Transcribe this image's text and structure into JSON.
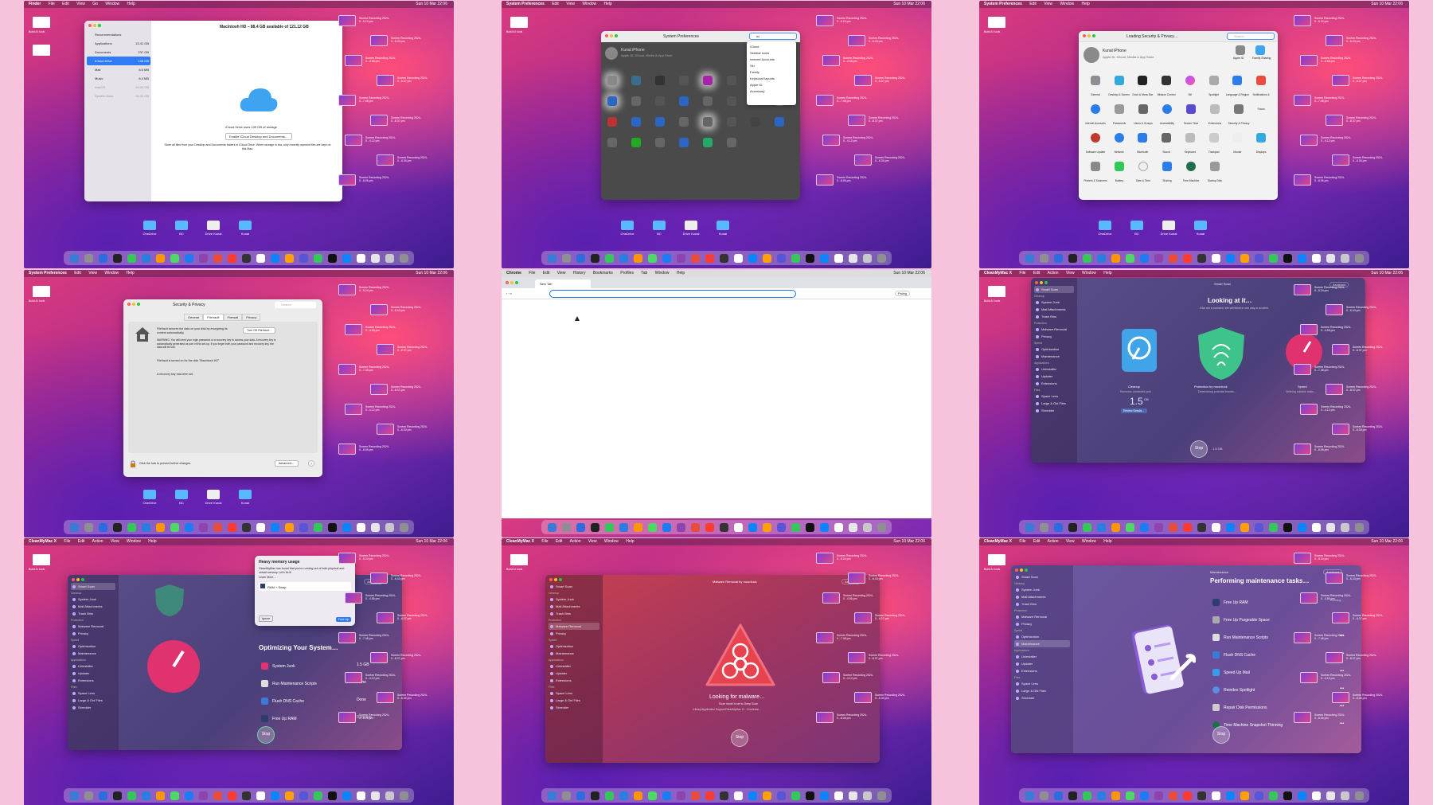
{
  "common": {
    "clock": "Sun 10 Mar 22:06",
    "user": "Kunal Lonhare",
    "left_icon_label": "Build AI tools",
    "desktop_icons": [
      "OneDrive",
      "BC",
      "Drive Kunal",
      "Kunal"
    ],
    "recordings": [
      "Screen Recording 2024-0...5.24 pm",
      "Screen Recording 2024-0...6.43 pm",
      "Screen Recording 2024-0...4.55 pm",
      "Screen Recording 2024-0...6.37 pm",
      "Screen Recording 2024-0...7.48 pm",
      "Screen Recording 2024-0...8.37 pm",
      "Screen Recording 2024-0...4.12 pm",
      "Screen Recording 2024-0...6.30 pm",
      "Screen Recording 2024-0...8.06 pm"
    ],
    "dock_colors": [
      "#3a7bd5",
      "#8e8e93",
      "#2d6cdf",
      "#222",
      "#34c759",
      "#2a7de1",
      "#ff9500",
      "#4cd964",
      "#1c7cf4",
      "#8e44ad",
      "#e74c3c",
      "#ff3b30",
      "#333",
      "#ffffff",
      "#0a84ff",
      "#ff9f0a",
      "#5856d6",
      "#34c759",
      "#111",
      "#0a84ff",
      "#ffffff",
      "#e5e5ea",
      "#c7c7cc",
      "#8e8e93"
    ]
  },
  "p0": {
    "menu": [
      "Finder",
      "File",
      "Edit",
      "View",
      "Go",
      "Window",
      "Help"
    ],
    "title": "Macintosh HD – 88.4 GB available of 121.12 GB",
    "sidebar": [
      {
        "label": "Recommendations",
        "size": ""
      },
      {
        "label": "Applications",
        "size": "13.41 GB"
      },
      {
        "label": "Documents",
        "size": "237 GB"
      },
      {
        "label": "iCloud Drive",
        "size": "138 GB"
      },
      {
        "label": "Mail",
        "size": "8.6 MB"
      },
      {
        "label": "Music",
        "size": "8.4 MB"
      },
      {
        "label": "macOS",
        "size": "19.42 GB"
      },
      {
        "label": "System Data",
        "size": "16.32 GB"
      }
    ],
    "line1": "iCloud Drive uses 139 GB of storage",
    "button": "Enable iCloud Desktop and Documents…",
    "desc": "Store all files from your Desktop and Documents folders in iCloud Drive. When storage is low, only recently opened files are kept on this Mac."
  },
  "p1": {
    "menu": [
      "System Preferences",
      "Edit",
      "View",
      "Window",
      "Help"
    ],
    "title": "System Preferences",
    "search_value": "icl",
    "account": "Kunal iPhone",
    "account_sub": "Apple ID, iCloud, Media & App Store",
    "suggestions": [
      "iCloud",
      "Sidebar icons",
      "Internet Accounts",
      "Siri",
      "Family",
      "Keyboard layouts",
      "Apple ID",
      "Accessory"
    ]
  },
  "p2": {
    "menu": [
      "System Preferences",
      "Edit",
      "View",
      "Window",
      "Help"
    ],
    "title": "Loading Security & Privacy…",
    "search_placeholder": "Search",
    "account": "Kunal iPhone",
    "account_sub": "Apple ID, iCloud, Media & App Store",
    "top_icons": [
      "Apple ID",
      "Family Sharing"
    ],
    "rows": [
      [
        "General",
        "Desktop & Screen Saver",
        "Dock & Menu Bar",
        "Mission Control",
        "Siri",
        "Spotlight",
        "Language & Region",
        "Notifications & Focus"
      ],
      [
        "Internet Accounts",
        "Passwords",
        "Users & Groups",
        "Accessibility",
        "Screen Time",
        "Extensions",
        "Security & Privacy"
      ],
      [
        "Software Update",
        "Network",
        "Bluetooth",
        "Sound",
        "Keyboard",
        "Trackpad",
        "Mouse",
        "Displays"
      ],
      [
        "Printers & Scanners",
        "Battery",
        "Date & Time",
        "Sharing",
        "Time Machine",
        "Startup Disk"
      ]
    ]
  },
  "p3": {
    "menu": [
      "System Preferences",
      "Edit",
      "View",
      "Window",
      "Help"
    ],
    "title": "Security & Privacy",
    "search_placeholder": "Search",
    "tabs": [
      "General",
      "FileVault",
      "Firewall",
      "Privacy"
    ],
    "fv_desc": "FileVault secures the data on your disk by encrypting its content automatically.",
    "turn_off": "Turn Off FileVault…",
    "warning": "WARNING: You will need your login password or a recovery key to access your data. A recovery key is automatically generated as part of this set-up. If you forget both your password and recovery key, the data will be lost.",
    "status": "FileVault is turned on for the disk \"Macintosh HD\".",
    "recovery": "A recovery key has been set.",
    "lock_text": "Click the lock to prevent further changes.",
    "advanced": "Advanced…",
    "help": "?"
  },
  "p4": {
    "menu": [
      "Chrome",
      "File",
      "Edit",
      "View",
      "History",
      "Bookmarks",
      "Profiles",
      "Tab",
      "Window",
      "Help"
    ],
    "tab": "New Tab",
    "profile": "Paling"
  },
  "p5": {
    "menu": [
      "CleanMyMac X",
      "File",
      "Edit",
      "Action",
      "View",
      "Window",
      "Help"
    ],
    "header": "Smart Scan",
    "assistant": "Assistant",
    "title": "Looking at it…",
    "subtitle": "Give me a moment. We will finish in one way or another.",
    "sidebar_sections": [
      {
        "h": "",
        "items": [
          "Smart Scan"
        ]
      },
      {
        "h": "Cleanup",
        "items": [
          "System Junk",
          "Mail Attachments",
          "Trash Bins"
        ]
      },
      {
        "h": "Protection",
        "items": [
          "Malware Removal",
          "Privacy"
        ]
      },
      {
        "h": "Speed",
        "items": [
          "Optimization",
          "Maintenance"
        ]
      },
      {
        "h": "Applications",
        "items": [
          "Uninstaller",
          "Updater",
          "Extensions"
        ]
      },
      {
        "h": "Files",
        "items": [
          "Space Lens",
          "Large & Old Files",
          "Shredder"
        ]
      }
    ],
    "cards": [
      {
        "title": "Cleanup",
        "sub": "Removes unneeded junk"
      },
      {
        "title": "Protection by moonlock",
        "sub": "Determining potential threats…"
      },
      {
        "title": "Speed",
        "sub": "Defining suitable tasks…"
      }
    ],
    "size_value": "1.5",
    "size_unit": "GB",
    "review": "Review Details…",
    "stop": "Stop",
    "stop_size": "1.5 GB"
  },
  "p6": {
    "menu": [
      "CleanMyMac X",
      "File",
      "Edit",
      "Action",
      "View",
      "Window",
      "Help"
    ],
    "assistant": "Assistant",
    "popup_title": "Heavy memory usage",
    "popup_body": "CleanMyMac has found that you're running out of both physical and virtual memory. Let's fix it!",
    "popup_learn": "Learn More…",
    "popup_item": "RAM + Swap",
    "popup_ignore": "Ignore",
    "popup_free": "Free Up",
    "title": "Optimizing Your System…",
    "tasks": [
      {
        "name": "System Junk",
        "status": "1.5 GB"
      },
      {
        "name": "Run Maintenance Scripts",
        "status": "Done"
      },
      {
        "name": "Flush DNS Cache",
        "status": "Done"
      },
      {
        "name": "Free Up RAM",
        "status": "Running…"
      }
    ],
    "stop": "Stop"
  },
  "p7": {
    "menu": [
      "CleanMyMac X",
      "File",
      "Edit",
      "Action",
      "View",
      "Window",
      "Help"
    ],
    "header": "Malware Removal by moonlock",
    "assistant": "Assistant",
    "title": "Looking for malware…",
    "subtitle": "Scan mode is set to Deep Scan",
    "path": "/Library/Application Support/CleanMyMac X/…/Contents/…",
    "stop": "Stop"
  },
  "p8": {
    "menu": [
      "CleanMyMac X",
      "File",
      "Edit",
      "Action",
      "View",
      "Window",
      "Help"
    ],
    "header": "Maintenance",
    "assistant": "Assistant",
    "title": "Performing maintenance tasks…",
    "tasks": [
      {
        "name": "Free Up RAM",
        "status": "Running…"
      },
      {
        "name": "Free Up Purgeable Space",
        "status": "•••"
      },
      {
        "name": "Run Maintenance Scripts",
        "status": "•••"
      },
      {
        "name": "Flush DNS Cache",
        "status": "•••"
      },
      {
        "name": "Speed Up Mail",
        "status": "•••"
      },
      {
        "name": "Reindex Spotlight",
        "status": "•••"
      },
      {
        "name": "Repair Disk Permissions",
        "status": "•••"
      },
      {
        "name": "Time Machine Snapshot Thinning",
        "status": "•••"
      }
    ],
    "stop": "Stop"
  }
}
